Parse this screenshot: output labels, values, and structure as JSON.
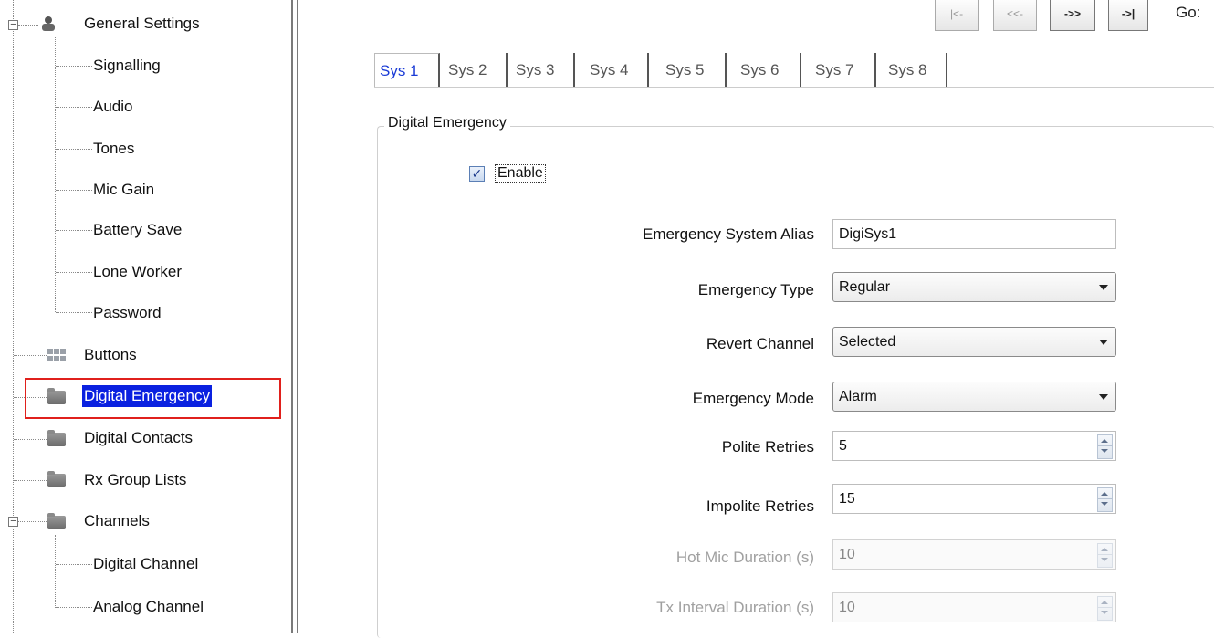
{
  "tree": {
    "items": [
      {
        "label": "General Settings"
      },
      {
        "label": "Signalling"
      },
      {
        "label": "Audio"
      },
      {
        "label": "Tones"
      },
      {
        "label": "Mic Gain"
      },
      {
        "label": "Battery Save"
      },
      {
        "label": "Lone Worker"
      },
      {
        "label": "Password"
      },
      {
        "label": "Buttons"
      },
      {
        "label": "Digital Emergency"
      },
      {
        "label": "Digital Contacts"
      },
      {
        "label": "Rx Group Lists"
      },
      {
        "label": "Channels"
      },
      {
        "label": "Digital Channel"
      },
      {
        "label": "Analog Channel"
      }
    ],
    "expander_symbol": "−"
  },
  "nav": {
    "first": "|<-",
    "prev": "<<-",
    "next": "->>",
    "last": "->|",
    "goto": "Go:"
  },
  "tabs": [
    "Sys 1",
    "Sys 2",
    "Sys 3",
    "Sys 4",
    "Sys 5",
    "Sys 6",
    "Sys 7",
    "Sys 8"
  ],
  "group": {
    "title": "Digital Emergency",
    "enable_label": "Enable",
    "enable_checked": true,
    "check_mark": "✓",
    "fields": {
      "alias": {
        "label": "Emergency System Alias",
        "value": "DigiSys1"
      },
      "type": {
        "label": "Emergency Type",
        "value": "Regular"
      },
      "revert": {
        "label": "Revert Channel",
        "value": "Selected"
      },
      "mode": {
        "label": "Emergency Mode",
        "value": "Alarm"
      },
      "polite": {
        "label": "Polite Retries",
        "value": "5"
      },
      "impolite": {
        "label": "Impolite Retries",
        "value": "15"
      },
      "hotmic": {
        "label": "Hot Mic Duration (s)",
        "value": "10"
      },
      "txinterval": {
        "label": "Tx Interval Duration (s)",
        "value": "10"
      }
    }
  },
  "colors": {
    "selection": "#0a21e0",
    "highlight_box": "#e0201c",
    "active_tab": "#1a3bd6"
  }
}
